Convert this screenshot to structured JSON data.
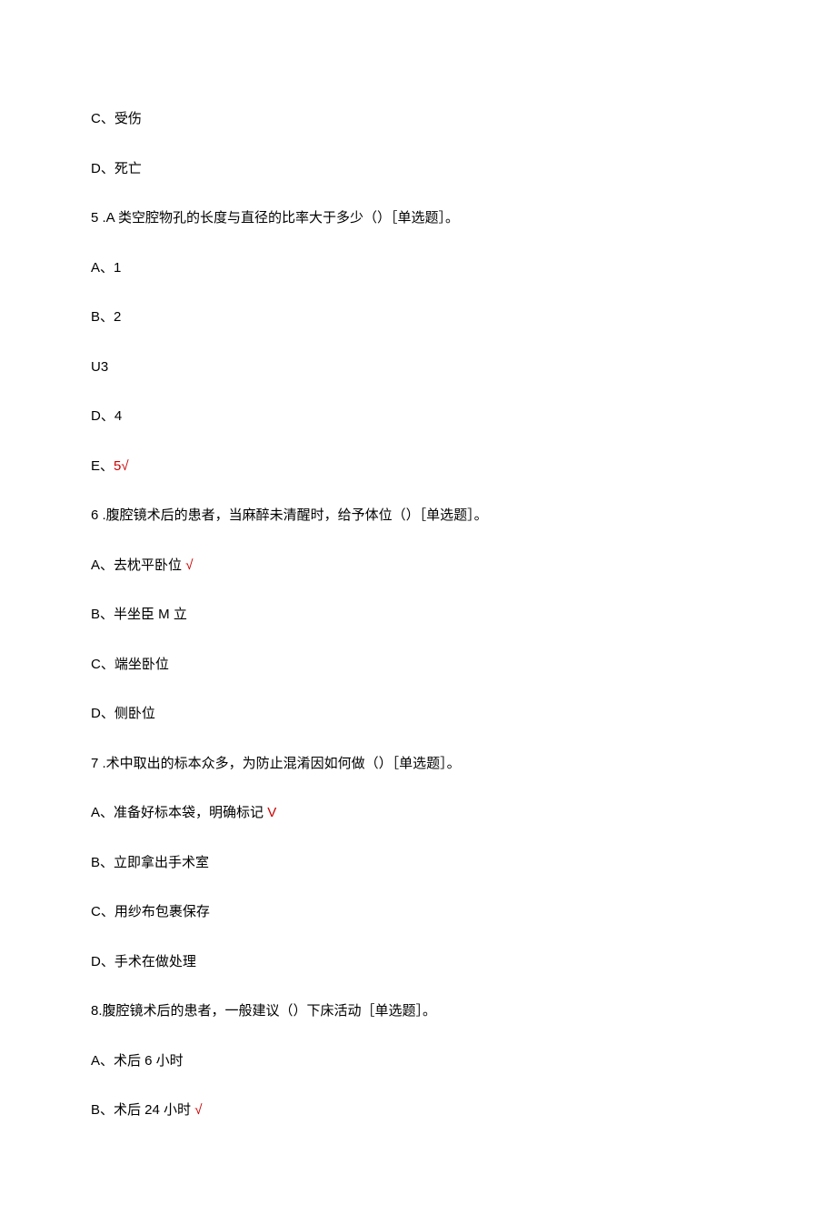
{
  "items": [
    {
      "text": "C、受伤",
      "correct": false,
      "correctText": false
    },
    {
      "text": "D、死亡",
      "correct": false,
      "correctText": false
    },
    {
      "text": "5 .A 类空腔物孔的长度与直径的比率大于多少（）［单选题］。",
      "correct": false,
      "correctText": false
    },
    {
      "text": "A、1",
      "correct": false,
      "correctText": false
    },
    {
      "text": "B、2",
      "correct": false,
      "correctText": false
    },
    {
      "text": "U3",
      "correct": false,
      "correctText": false
    },
    {
      "text": "D、4",
      "correct": false,
      "correctText": false
    },
    {
      "text": "E、",
      "suffix": "5√",
      "correct": false,
      "correctText": true
    },
    {
      "text": "6 .腹腔镜术后的患者，当麻醉未清醒时，给予体位（）［单选题］。",
      "correct": false,
      "correctText": false
    },
    {
      "text": "A、去枕平卧位 ",
      "correct": true,
      "correctText": false
    },
    {
      "text": "B、半坐臣 M 立",
      "correct": false,
      "correctText": false
    },
    {
      "text": "C、端坐卧位",
      "correct": false,
      "correctText": false
    },
    {
      "text": "D、侧卧位",
      "correct": false,
      "correctText": false
    },
    {
      "text": "7 .术中取出的标本众多，为防止混淆因如何做（）［单选题］。",
      "correct": false,
      "correctText": false
    },
    {
      "text": "A、准备好标本袋，明确标记 ",
      "correct": true,
      "correctText": false,
      "mark": "V"
    },
    {
      "text": "B、立即拿出手术室",
      "correct": false,
      "correctText": false
    },
    {
      "text": "C、用纱布包裹保存",
      "correct": false,
      "correctText": false
    },
    {
      "text": "D、手术在做处理",
      "correct": false,
      "correctText": false
    },
    {
      "text": "8.腹腔镜术后的患者，一般建议（）下床活动［单选题］。",
      "correct": false,
      "correctText": false
    },
    {
      "text": "A、术后 6 小时",
      "correct": false,
      "correctText": false
    },
    {
      "text": "B、术后 24 小时 ",
      "correct": true,
      "correctText": false
    }
  ],
  "defaultMark": "√"
}
